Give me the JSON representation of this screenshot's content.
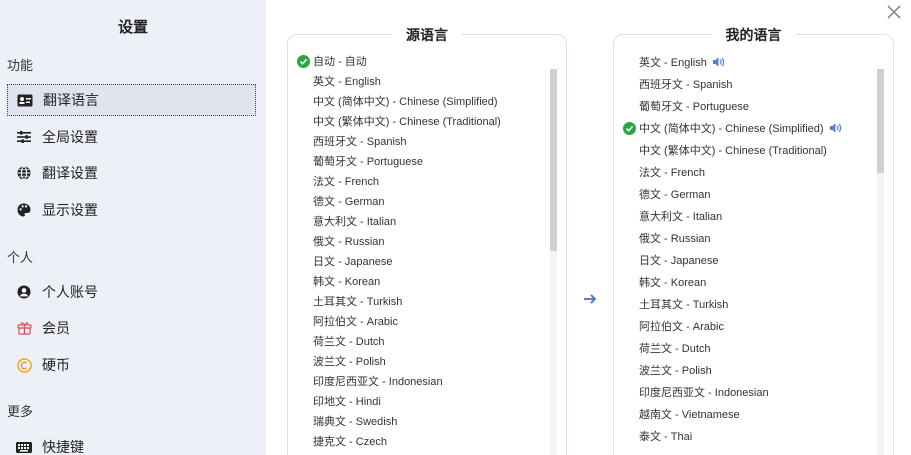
{
  "sidebar": {
    "title": "设置",
    "sections": {
      "features": "功能",
      "personal": "个人",
      "more": "更多"
    },
    "items": [
      {
        "label": "翻译语言",
        "icon": "id-card-icon",
        "active": true
      },
      {
        "label": "全局设置",
        "icon": "sliders-icon",
        "active": false
      },
      {
        "label": "翻译设置",
        "icon": "globe-icon",
        "active": false
      },
      {
        "label": "显示设置",
        "icon": "palette-icon",
        "active": false
      },
      {
        "label": "个人账号",
        "icon": "user-icon",
        "active": false
      },
      {
        "label": "会员",
        "icon": "gift-icon",
        "active": false
      },
      {
        "label": "硬币",
        "icon": "coin-icon",
        "active": false
      },
      {
        "label": "快捷键",
        "icon": "keyboard-icon",
        "active": false
      }
    ]
  },
  "source_panel": {
    "title": "源语言",
    "selected": "自动 - 自动",
    "languages": [
      "自动 - 自动",
      "英文 - English",
      "中文 (简体中文) - Chinese (Simplified)",
      "中文 (繁体中文) - Chinese (Traditional)",
      "西班牙文 - Spanish",
      "葡萄牙文 - Portuguese",
      "法文 - French",
      "德文 - German",
      "意大利文 - Italian",
      "俄文 - Russian",
      "日文 - Japanese",
      "韩文 - Korean",
      "土耳其文 - Turkish",
      "阿拉伯文 - Arabic",
      "荷兰文 - Dutch",
      "波兰文 - Polish",
      "印度尼西亚文 - Indonesian",
      "印地文 - Hindi",
      "瑞典文 - Swedish",
      "捷克文 - Czech"
    ]
  },
  "target_panel": {
    "title": "我的语言",
    "selected": "中文 (简体中文) - Chinese (Simplified)",
    "languages": [
      "英文 - English",
      "西班牙文 - Spanish",
      "葡萄牙文 - Portuguese",
      "中文 (简体中文) - Chinese (Simplified)",
      "中文 (繁体中文) - Chinese (Traditional)",
      "法文 - French",
      "德文 - German",
      "意大利文 - Italian",
      "俄文 - Russian",
      "日文 - Japanese",
      "韩文 - Korean",
      "土耳其文 - Turkish",
      "阿拉伯文 - Arabic",
      "荷兰文 - Dutch",
      "波兰文 - Polish",
      "印度尼西亚文 - Indonesian",
      "越南文 - Vietnamese",
      "泰文 - Thai"
    ]
  },
  "colors": {
    "sidebar_bg": "#eef0f8",
    "check_green": "#27a844",
    "speaker_blue": "#5b7fd6",
    "arrow_blue": "#4a6fd1"
  }
}
